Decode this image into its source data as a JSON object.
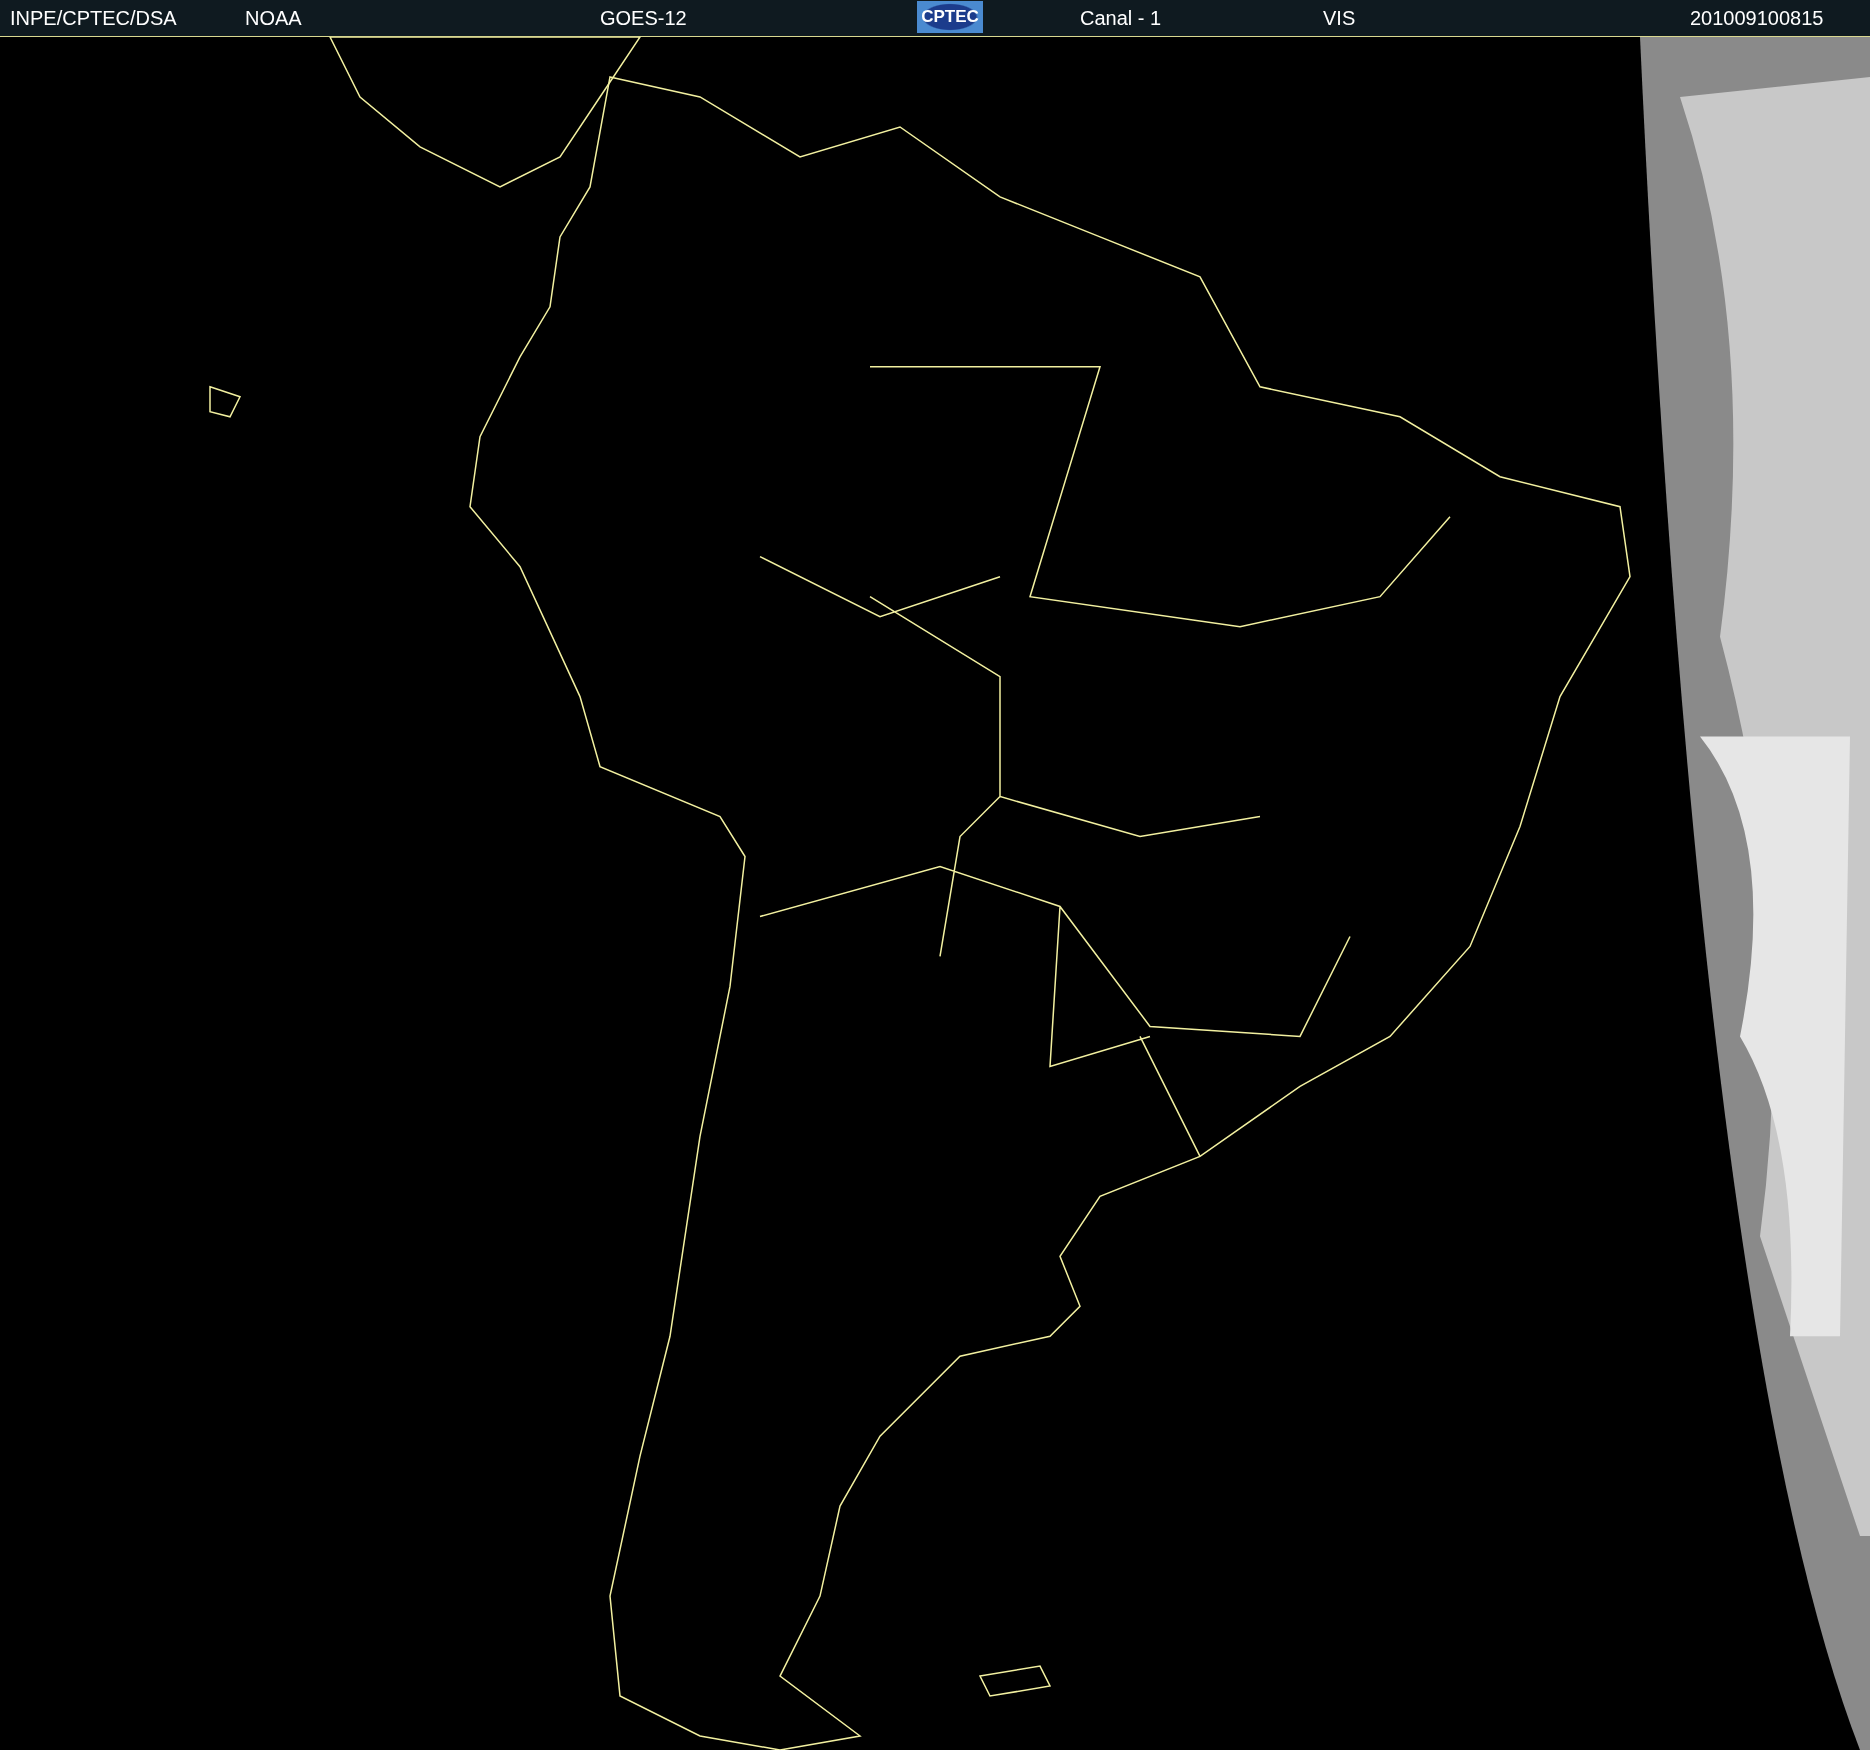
{
  "header": {
    "items": [
      {
        "kind": "text",
        "text": "INPE/CPTEC/DSA"
      },
      {
        "kind": "text",
        "text": "NOAA"
      },
      {
        "kind": "text",
        "text": "GOES-12"
      },
      {
        "kind": "logo",
        "text": "CPTEC"
      },
      {
        "kind": "text",
        "text": "Canal - 1"
      },
      {
        "kind": "text",
        "text": "VIS"
      },
      {
        "kind": "text",
        "text": "201009100815"
      }
    ]
  }
}
